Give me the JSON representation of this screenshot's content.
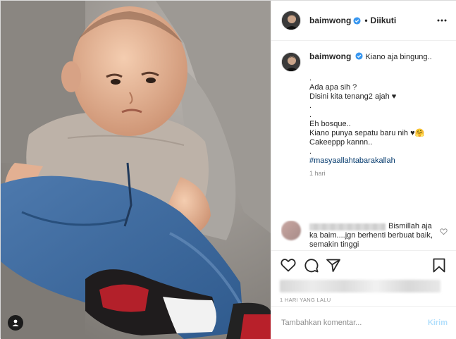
{
  "post": {
    "username": "baimwong",
    "follow_state": "Diikuti",
    "separator": "•",
    "caption_first": "Kiano aja bingung..",
    "caption_body": ".\nAda apa sih ?\nDisini kita tenang2 ajah ♥\n.\n.\nEh bosque..\nKiano punya sepatu baru nih ♥🤗\nCakeeppp kannn..\n.\n",
    "hashtag": "#masyaallahtabarakallah",
    "time_ago": "1 hari",
    "comment_text": "Bismillah aja ka baim....jgn berhenti berbuat baik, semakin tinggi",
    "date": "1 HARI YANG LALU",
    "comment_placeholder": "Tambahkan komentar...",
    "post_label": "Kirim"
  },
  "icons": {
    "verified": "verified-badge-icon",
    "more": "more-options-icon",
    "load_more": "plus-circle-icon",
    "like": "heart-icon",
    "comment": "comment-bubble-icon",
    "share": "paper-plane-icon",
    "save": "bookmark-icon",
    "user_tag": "user-tag-icon"
  },
  "colors": {
    "verified": "#3897f0",
    "hashtag": "#00376b",
    "muted": "#8e8e8e",
    "post_button": "#b2dffc"
  }
}
